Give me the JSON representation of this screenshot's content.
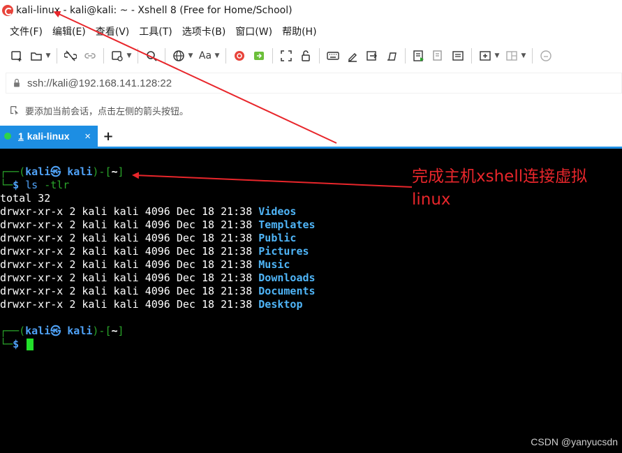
{
  "window": {
    "title": "kali-linux - kali@kali: ~ - Xshell 8 (Free for Home/School)"
  },
  "menu": {
    "items": [
      "文件(F)",
      "编辑(E)",
      "查看(V)",
      "工具(T)",
      "选项卡(B)",
      "窗口(W)",
      "帮助(H)"
    ]
  },
  "address": {
    "value": "ssh://kali@192.168.141.128:22"
  },
  "hint": {
    "text": "要添加当前会话，点击左侧的箭头按钮。"
  },
  "tabs": {
    "number": "1",
    "label": "kali-linux",
    "close": "×",
    "add": "+"
  },
  "terminal": {
    "prompt_user": "kali㉿ kali",
    "prompt_dir": "~",
    "command": "ls",
    "command_args": "-tlr",
    "prompt_symbol": "$",
    "total": "total 32",
    "entries": [
      {
        "meta": "drwxr-xr-x 2 kali kali 4096 Dec 18 21:38 ",
        "name": "Videos"
      },
      {
        "meta": "drwxr-xr-x 2 kali kali 4096 Dec 18 21:38 ",
        "name": "Templates"
      },
      {
        "meta": "drwxr-xr-x 2 kali kali 4096 Dec 18 21:38 ",
        "name": "Public"
      },
      {
        "meta": "drwxr-xr-x 2 kali kali 4096 Dec 18 21:38 ",
        "name": "Pictures"
      },
      {
        "meta": "drwxr-xr-x 2 kali kali 4096 Dec 18 21:38 ",
        "name": "Music"
      },
      {
        "meta": "drwxr-xr-x 2 kali kali 4096 Dec 18 21:38 ",
        "name": "Downloads"
      },
      {
        "meta": "drwxr-xr-x 2 kali kali 4096 Dec 18 21:38 ",
        "name": "Documents"
      },
      {
        "meta": "drwxr-xr-x 2 kali kali 4096 Dec 18 21:38 ",
        "name": "Desktop"
      }
    ]
  },
  "annotation": {
    "text": "完成主机xshell连接虚拟linux"
  },
  "watermark": "CSDN @yanyucsdn",
  "colors": {
    "tab_active": "#1d8ee3",
    "terminal_bg": "#000000",
    "prompt_green": "#2aa52a",
    "prompt_blue": "#4fa2f7",
    "cursor": "#22e02a",
    "annotation_red": "#e8262b"
  },
  "icons": {
    "toolbar": [
      "new-session-icon",
      "open-folder-icon",
      "disconnect-icon",
      "reconnect-icon",
      "transfer-icon",
      "find-icon",
      "globe-icon",
      "font-icon",
      "xftp-icon",
      "xagent-icon",
      "fullscreen-icon",
      "lock-icon",
      "keyboard-icon",
      "highlight-icon",
      "script-icon",
      "edit-icon",
      "log-icon",
      "copy-icon",
      "paste-icon",
      "new-tab-icon",
      "layout-icon",
      "chat-icon"
    ]
  }
}
